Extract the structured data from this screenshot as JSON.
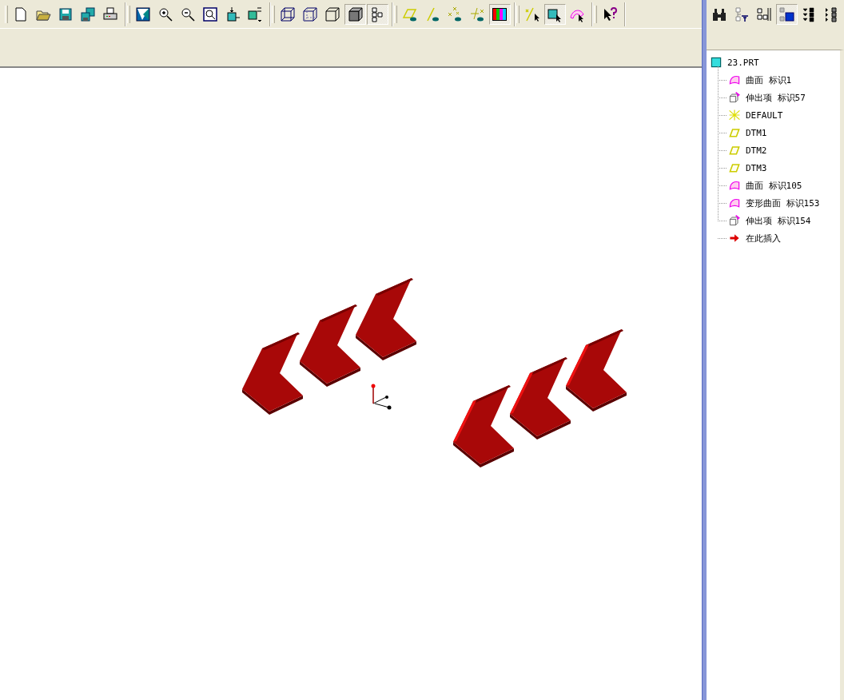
{
  "toolbar": {
    "groups": [
      [
        {
          "kind": "new",
          "pressed": false
        },
        {
          "kind": "open",
          "pressed": false
        },
        {
          "kind": "save",
          "pressed": false
        },
        {
          "kind": "save-copy",
          "pressed": false
        },
        {
          "kind": "print",
          "pressed": false
        }
      ],
      [
        {
          "kind": "repaint",
          "pressed": false
        },
        {
          "kind": "zoom-in",
          "pressed": false
        },
        {
          "kind": "zoom-out",
          "pressed": false
        },
        {
          "kind": "refit",
          "pressed": false
        },
        {
          "kind": "orient",
          "pressed": false
        },
        {
          "kind": "views",
          "pressed": false
        }
      ],
      [
        {
          "kind": "wireframe",
          "pressed": false
        },
        {
          "kind": "hidden",
          "pressed": false
        },
        {
          "kind": "no-hidden",
          "pressed": false
        },
        {
          "kind": "shaded",
          "pressed": true
        },
        {
          "kind": "tree",
          "pressed": true
        }
      ],
      [
        {
          "kind": "planes",
          "pressed": false
        },
        {
          "kind": "axes",
          "pressed": false
        },
        {
          "kind": "points",
          "pressed": false
        },
        {
          "kind": "csys",
          "pressed": false
        },
        {
          "kind": "color",
          "pressed": true
        }
      ],
      [
        {
          "kind": "pick-line",
          "pressed": false
        },
        {
          "kind": "pick-cube",
          "pressed": true
        },
        {
          "kind": "pick-surface",
          "pressed": false
        }
      ],
      [
        {
          "kind": "help",
          "pressed": false
        }
      ]
    ]
  },
  "side_toolbar": [
    {
      "kind": "find",
      "pressed": false
    },
    {
      "kind": "filter",
      "pressed": false
    },
    {
      "kind": "columns",
      "pressed": false
    },
    {
      "kind": "tree-panel",
      "pressed": true
    },
    {
      "kind": "collapse",
      "pressed": false
    },
    {
      "kind": "expand",
      "pressed": false
    }
  ],
  "tree": {
    "root": {
      "label": "23.PRT"
    },
    "children": [
      {
        "kind": "surface",
        "label": "曲面 标识1"
      },
      {
        "kind": "protrusion",
        "label": "伸出项 标识57"
      },
      {
        "kind": "csys",
        "label": "DEFAULT"
      },
      {
        "kind": "plane",
        "label": "DTM1"
      },
      {
        "kind": "plane",
        "label": "DTM2"
      },
      {
        "kind": "plane",
        "label": "DTM3"
      },
      {
        "kind": "surface",
        "label": "曲面 标识105"
      },
      {
        "kind": "surface",
        "label": "变形曲面 标识153"
      },
      {
        "kind": "protrusion",
        "label": "伸出项 标识154"
      },
      {
        "kind": "insert",
        "label": "在此插入"
      }
    ]
  }
}
